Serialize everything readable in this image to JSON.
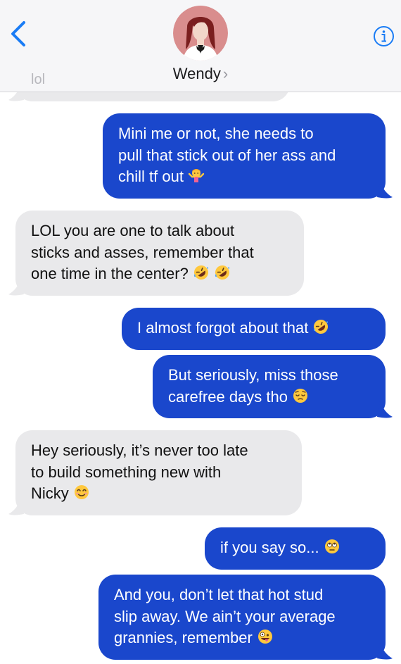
{
  "header": {
    "contact_name": "Wendy",
    "chevron": "›",
    "back_icon": "chevron-left-icon",
    "info_icon": "info-icon",
    "accent": "#1a7cf5",
    "partial_message": "lol"
  },
  "colors": {
    "outgoing_bubble": "#1a47cc",
    "incoming_bubble": "#e9e9eb"
  },
  "messages": [
    {
      "side": "out",
      "text": "Mini me or not, she needs to\npull that stick out of her ass and\nchill tf out",
      "emoji": "person-shrugging-emoji"
    },
    {
      "side": "in",
      "text": "LOL you are one to talk about\nsticks and asses, remember that\none time in the center?",
      "emoji": "rolling-on-floor-laughing-emoji x2"
    },
    {
      "side": "out",
      "text": "I almost forgot about that",
      "emoji": "rolling-on-floor-laughing-emoji"
    },
    {
      "side": "out",
      "text": "But seriously, miss those\ncarefree days tho",
      "emoji": "pensive-face-emoji"
    },
    {
      "side": "in",
      "text": "Hey seriously, it’s never too late\nto build something new with\nNicky",
      "emoji": "smiling-face-with-smiling-eyes-emoji"
    },
    {
      "side": "out",
      "text": "if you say so...",
      "emoji": "face-with-rolling-eyes-emoji"
    },
    {
      "side": "out",
      "text": "And you, don’t let that hot stud\nslip away. We ain’t your average\ngrannies, remember",
      "emoji": "zany-face-emoji"
    }
  ]
}
